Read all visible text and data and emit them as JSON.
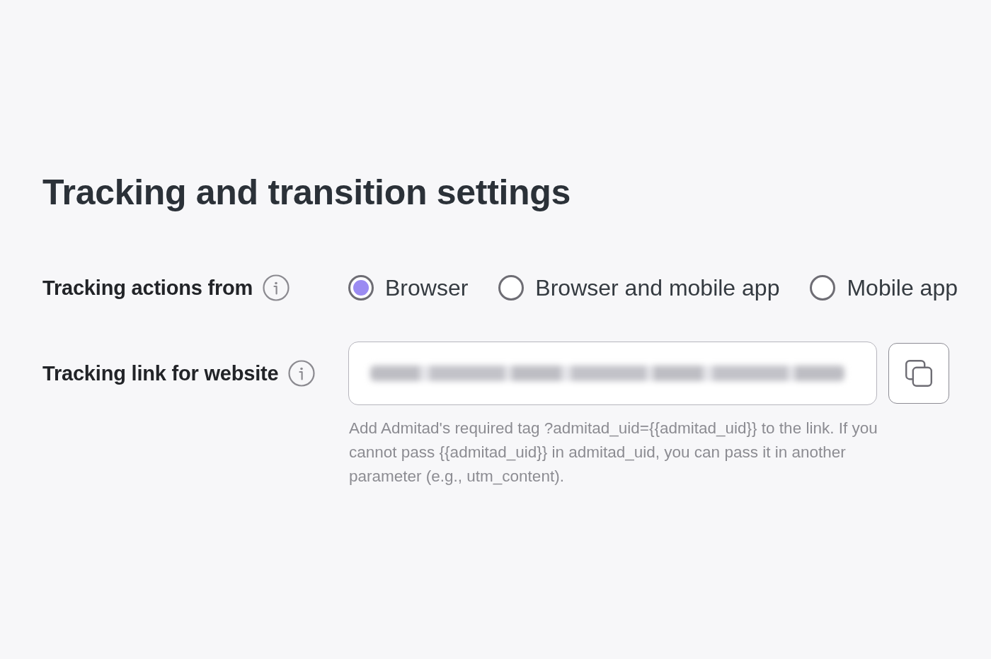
{
  "title": "Tracking and transition settings",
  "tracking_actions": {
    "label": "Tracking actions from",
    "options": [
      {
        "label": "Browser",
        "selected": true
      },
      {
        "label": "Browser and mobile app",
        "selected": false
      },
      {
        "label": "Mobile app",
        "selected": false
      }
    ]
  },
  "tracking_link": {
    "label": "Tracking link for website",
    "value_blurred": true,
    "hint": "Add Admitad's required tag ?admitad_uid={{admitad_uid}} to the link. If you cannot pass {{admitad_uid}} in admitad_uid, you can pass it in another parameter (e.g., utm_content)."
  }
}
